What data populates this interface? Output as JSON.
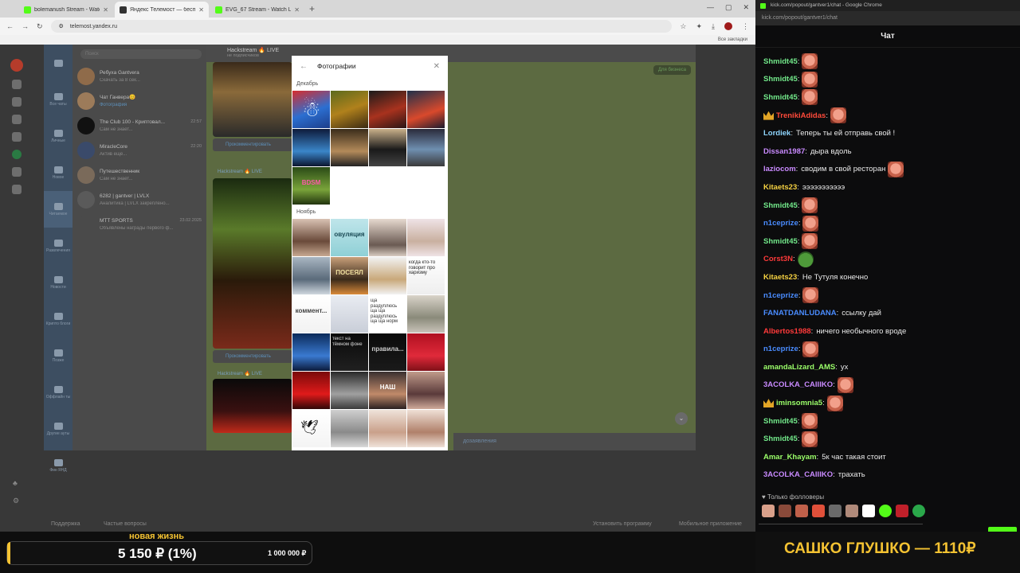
{
  "browser": {
    "tabs": [
      {
        "label": "bolemanush Stream - Watch Live",
        "color": "#53fc18"
      },
      {
        "label": "Яндекс Телемост — бесплатн...",
        "color": "#333333",
        "active": true
      },
      {
        "label": "EVG_67 Stream - Watch Live on",
        "color": "#53fc18"
      }
    ],
    "new_tab": "+",
    "url": "telemost.yandex.ru",
    "bookmarks_label": "Все закладки"
  },
  "telegram": {
    "search_placeholder": "Поиск",
    "nav": [
      "Все чаты",
      "Личные",
      "Новое",
      "Читаемое",
      "Развлечения",
      "Новости",
      "Крипто блоги",
      "Позже",
      "Оффлайн ты",
      "Другие ауты",
      "Фин ЯНД"
    ],
    "chats": [
      {
        "name": "Ребуха Gantvera",
        "msg": "Скачать за 8 сек...",
        "time": "",
        "color": "#8f6b4a"
      },
      {
        "name": "Чат Ганвера😊",
        "msg": "Фотография",
        "time": "",
        "color": "#9c7b5a",
        "blue": true
      },
      {
        "name": "The Club 100 - Криптовал...",
        "msg": "Сам не знает...",
        "time": "22:57",
        "color": "#111111"
      },
      {
        "name": "MiracleCore",
        "msg": "Актив ещё...",
        "time": "22:20",
        "color": "#3a4a6a"
      },
      {
        "name": "Путешественник",
        "msg": "Сам не знает...",
        "time": "",
        "color": "#7a6a5a"
      },
      {
        "name": "6282 | gantver | LVLX",
        "msg": "Аналитика | LVLX закреплено...",
        "time": "",
        "color": "#5a5a5a"
      },
      {
        "name": "MTT SPORTS",
        "msg": "Объявлены награды первого ф...",
        "time": "23.02.2025",
        "color": "#4a4a4a"
      }
    ],
    "channel_title": "Hackstream 🔥 LIVE",
    "channel_sub": "не подписчиков",
    "biz_button": "Для бизнеса",
    "comment_label": "Прокомментировать",
    "post_title": "Hackstream 🔥 LIVE",
    "compose_placeholder": "дозаявления"
  },
  "telemost_bottom": {
    "support": "Поддержка",
    "faq": "Частые вопросы",
    "install": "Установить программу",
    "mobile": "Мобильное приложение"
  },
  "photos_modal": {
    "title": "Фотографии",
    "month_december": "Декабрь",
    "month_november": "Ноябрь",
    "december_photos": [
      {
        "bg": "linear-gradient(160deg,#d72d2d,#2c6fd1 55%,#1d3d8a)",
        "icon": "snowman"
      },
      {
        "bg": "linear-gradient(160deg,#5c6a1d,#b0811c 50%,#3b2a12)"
      },
      {
        "bg": "linear-gradient(160deg,#1b1b1b,#a8321e 55%,#2a1616)"
      },
      {
        "bg": "linear-gradient(160deg,#20304a,#d9492c 60%,#1a1a2e)"
      },
      {
        "bg": "linear-gradient(180deg,#0e1a3a,#3a86c9 60%,#0b1530)"
      },
      {
        "bg": "linear-gradient(180deg,#3a2c1a,#b38a5a 60%,#222)"
      },
      {
        "bg": "linear-gradient(180deg,#c9b08a,#1a1a1a 55%,#444)"
      },
      {
        "bg": "linear-gradient(180deg,#2a2a3a,#6f8fb0 55%,#3a3a3a)"
      },
      {
        "bg": "linear-gradient(180deg,#2a4a16,#7aa43a 60%,#22340e)",
        "caption": "BDSM",
        "caption_color": "#ff5aa8"
      }
    ],
    "november_photos": [
      {
        "bg": "linear-gradient(180deg,#d9c2b3,#6a4a3a 60%,#c7a891)"
      },
      {
        "bg": "linear-gradient(180deg,#bfe5ea,#8fd0d6)",
        "caption": "овуляция",
        "caption_color": "#1a4a55"
      },
      {
        "bg": "linear-gradient(180deg,#e6d9cf,#6a5a52 70%,#d9ccc2)"
      },
      {
        "bg": "linear-gradient(180deg,#efe3e6,#c9b0a0 60%,#efe3e6)"
      },
      {
        "bg": "linear-gradient(180deg,#a9b6c2,#5a6a7a 60%,#cfd7de)"
      },
      {
        "bg": "linear-gradient(180deg,#c9a07a,#3a2a1a 60%,#d98a3a)",
        "caption": "ПОСЕЯЛ",
        "caption_color": "#f0e0a0"
      },
      {
        "bg": "linear-gradient(180deg,#f2f2f2,#c9a87a 60%,#f2f2f2)"
      },
      {
        "bg": "linear-gradient(180deg,#ffffff,#eeeeee)",
        "caption": "когда кто-то говорит про харизму",
        "caption_color": "#222222"
      },
      {
        "bg": "linear-gradient(180deg,#ffffff,#f2f2f2)",
        "caption": "коммент...",
        "caption_color": "#444444"
      },
      {
        "bg": "linear-gradient(180deg,#e9ecf2,#c9ced8)"
      },
      {
        "bg": "linear-gradient(180deg,#ffffff,#ffffff)",
        "caption": "ща раздуплюсь ща ща раздуплюсь ща ща норм",
        "caption_color": "#333333"
      },
      {
        "bg": "linear-gradient(180deg,#d9d3c9,#8a8a7a 60%,#c9c3b9)"
      },
      {
        "bg": "linear-gradient(180deg,#0b2a5a,#3a7ad0 60%,#0b1a3a)"
      },
      {
        "bg": "linear-gradient(180deg,#0a0a0a,#202020)",
        "caption": "текст на тёмном фоне",
        "caption_color": "#dddddd"
      },
      {
        "bg": "linear-gradient(180deg,#0a0a0a,#1a1a1a)",
        "caption": "правила...",
        "caption_color": "#cccccc"
      },
      {
        "bg": "linear-gradient(180deg,#b01020,#e02a3a 60%,#801018)"
      },
      {
        "bg": "linear-gradient(180deg,#7a0a0a,#e01a1a 60%,#300808)"
      },
      {
        "bg": "linear-gradient(180deg,#2a2a2a,#a0a0a0 60%,#3a3a3a)"
      },
      {
        "bg": "linear-gradient(180deg,#3a3030,#c08a6a 60%,#2a2020)",
        "caption": "НАШ",
        "caption_color": "#ffffff"
      },
      {
        "bg": "linear-gradient(180deg,#c09a8a,#5a3a3a 60%,#d0aa9a)"
      },
      {
        "bg": "linear-gradient(180deg,#ffffff,#f4f4f4)",
        "icon": "birds"
      },
      {
        "bg": "linear-gradient(180deg,#cfcfcf,#8a8a8a 60%,#d9d9d9)"
      },
      {
        "bg": "linear-gradient(180deg,#efe3da,#c9a08a 60%,#efe3da)"
      },
      {
        "bg": "linear-gradient(180deg,#efe0d6,#b0806a 60%,#efe0d6)"
      }
    ]
  },
  "kick": {
    "window_title": "kick.com/popout/gantver1/chat - Google Chrome",
    "url": "kick.com/popout/gantver1/chat",
    "header": "Чат",
    "messages": [
      {
        "user": "Shmidt45",
        "color": "#72e88a",
        "text": "",
        "emote": true
      },
      {
        "user": "Shmidt45",
        "color": "#72e88a",
        "text": "",
        "emote": true
      },
      {
        "user": "Shmidt45",
        "color": "#72e88a",
        "text": "",
        "emote": true
      },
      {
        "user": "TrenikiAdidas",
        "color": "#ff4a3a",
        "text": "",
        "emote": true,
        "crown": true
      },
      {
        "user": "Lordiek",
        "color": "#8fd6ff",
        "text": "Теперь ты ей отправь свой !"
      },
      {
        "user": "Dissan1987",
        "color": "#c98aff",
        "text": "дыра вдоль"
      },
      {
        "user": "laziocom",
        "color": "#c98aff",
        "text": "сводим в свой ресторан",
        "emote": true
      },
      {
        "user": "Kitaets23",
        "color": "#f5d142",
        "text": "эээээээээээ"
      },
      {
        "user": "Shmidt45",
        "color": "#72e88a",
        "text": "",
        "emote": true
      },
      {
        "user": "n1ceprize",
        "color": "#4a8cff",
        "text": "",
        "emote": true
      },
      {
        "user": "Shmidt45",
        "color": "#72e88a",
        "text": "",
        "emote": true
      },
      {
        "user": "Corst3N",
        "color": "#ff3a3a",
        "text": "",
        "emote": true,
        "pepe": true
      },
      {
        "user": "Kitaets23",
        "color": "#f5d142",
        "text": "Не Тутуля конечно"
      },
      {
        "user": "n1ceprize",
        "color": "#4a8cff",
        "text": "",
        "emote": true
      },
      {
        "user": "FANATDANLUDANA",
        "color": "#4a8cff",
        "text": "ссылку дай"
      },
      {
        "user": "Albertos1988",
        "color": "#ff3a3a",
        "text": "ничего необычного вроде"
      },
      {
        "user": "n1ceprize",
        "color": "#4a8cff",
        "text": "",
        "emote": true
      },
      {
        "user": "amandaLizard_AMS",
        "color": "#9bff6a",
        "text": "ух"
      },
      {
        "user": "3ACOLKA_CAIIIKO",
        "color": "#c98aff",
        "text": "",
        "emote": true
      },
      {
        "user": "iminsomnia5",
        "color": "#9bff6a",
        "text": "",
        "emote": true,
        "crown": true
      },
      {
        "user": "Shmidt45",
        "color": "#72e88a",
        "text": "",
        "emote": true
      },
      {
        "user": "Shmidt45",
        "color": "#72e88a",
        "text": "",
        "emote": true
      },
      {
        "user": "Amar_Khayam",
        "color": "#9bff6a",
        "text": "5к час такая стоит"
      },
      {
        "user": "3ACOLKA_CAIIIKO",
        "color": "#c98aff",
        "text": "трахать"
      }
    ],
    "followers_only": "Только фолловеры"
  },
  "donation_goal": {
    "title": "новая жизнь",
    "amount": "5 150 ₽ (1%)",
    "target": "1 000 000 ₽",
    "progress": 0.01
  },
  "banner": {
    "text": "САШКО ГЛУШКО — 1110₽"
  }
}
